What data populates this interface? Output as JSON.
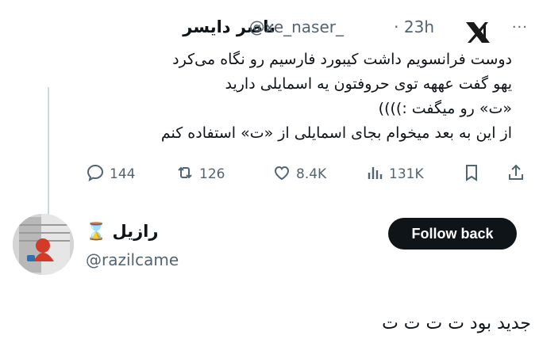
{
  "quoted_tweet": {
    "author_name": "ناصر دایسر",
    "handle": "@xe_naser_",
    "separator": "·",
    "time": "23h",
    "more_label": "···",
    "lines": [
      "دوست فرانسویم داشت کیبورد فارسیم رو نگاه می‌کرد",
      "یهو گفت عههه توی حروفتون یه اسمایلی دارید",
      "«ت» رو میگفت :))))",
      "از این به بعد میخوام بجای اسمایلی از «ت» استفاده کنم"
    ],
    "actions": {
      "replies": "144",
      "reposts": "126",
      "likes": "8.4K",
      "views": "131K"
    }
  },
  "reply": {
    "author_name": "رازیل ⌛️",
    "handle": "@razilcame",
    "follow_label": "Follow back",
    "text": "جدید بود ت ت ت ت"
  },
  "colors": {
    "text": "#0f1419",
    "secondary": "#536471",
    "button_bg": "#0f1419",
    "thread_line": "#cfd9de"
  },
  "icons": [
    "x-logo-icon",
    "more-icon",
    "reply-icon",
    "repost-icon",
    "like-icon",
    "views-icon",
    "bookmark-icon",
    "share-icon"
  ]
}
